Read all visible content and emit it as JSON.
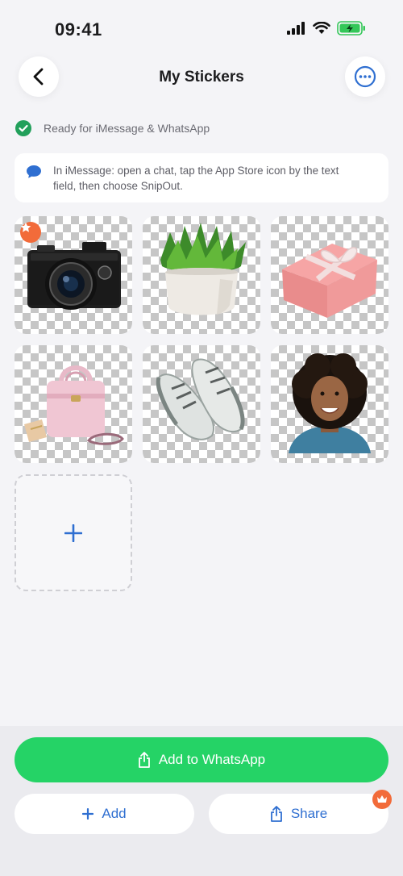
{
  "status_bar": {
    "time": "09:41"
  },
  "header": {
    "title": "My Stickers"
  },
  "status": {
    "text": "Ready for iMessage & WhatsApp",
    "accent": "#22a05b"
  },
  "info": {
    "line1": "In iMessage: open a chat, tap the App Store icon by the text",
    "line2": "field, then choose SnipOut."
  },
  "stickers": [
    {
      "subject": "camera",
      "featured": true
    },
    {
      "subject": "plant",
      "featured": false
    },
    {
      "subject": "gift-box",
      "featured": false
    },
    {
      "subject": "handbag",
      "featured": false
    },
    {
      "subject": "sneakers",
      "featured": false
    },
    {
      "subject": "portrait",
      "featured": false
    }
  ],
  "add_tile": {
    "icon": "plus-icon"
  },
  "actions": {
    "whatsapp_label": "Add to WhatsApp",
    "add_label": "Add",
    "share_label": "Share"
  },
  "colors": {
    "whatsapp_green": "#25d366",
    "accent_blue": "#2f6fd1",
    "badge_orange": "#f26b3a"
  }
}
